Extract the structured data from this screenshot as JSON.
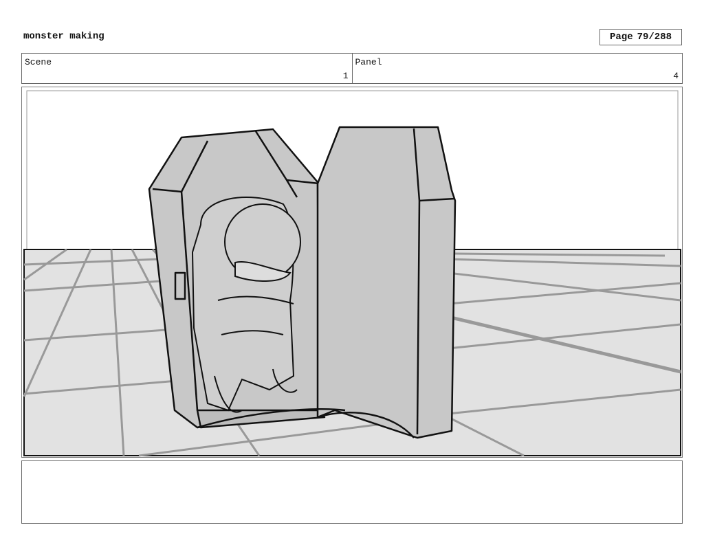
{
  "header": {
    "title": "monster making",
    "page_label": "Page",
    "page_number": "79/288"
  },
  "scene": {
    "label": "Scene",
    "value": "1"
  },
  "panel": {
    "label": "Panel",
    "value": "4"
  },
  "artwork": {
    "colors": {
      "floor": "#e2e2e2",
      "grid": "#999999",
      "coffin": "#c8c8c8",
      "ink": "#111111"
    }
  },
  "notes": {
    "text": ""
  }
}
